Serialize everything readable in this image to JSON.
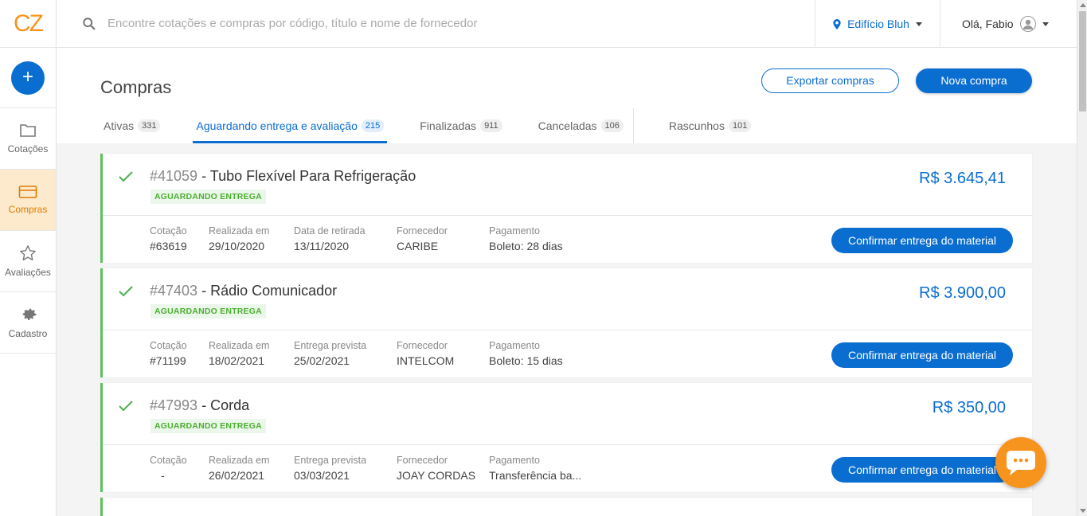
{
  "logo": "CZ",
  "sidebar": {
    "add_label": "+",
    "items": [
      {
        "label": "Cotações",
        "icon": "folder-icon"
      },
      {
        "label": "Compras",
        "icon": "card-icon",
        "active": true
      },
      {
        "label": "Avaliações",
        "icon": "star-icon"
      },
      {
        "label": "Cadastro",
        "icon": "gear-icon"
      }
    ]
  },
  "search": {
    "placeholder": "Encontre cotações e compras por código, título e nome de fornecedor"
  },
  "location": {
    "label": "Edifício Bluh"
  },
  "user": {
    "greeting": "Olá, Fabio"
  },
  "page": {
    "title": "Compras",
    "export_label": "Exportar compras",
    "new_label": "Nova compra"
  },
  "tabs": [
    {
      "label": "Ativas",
      "count": "331"
    },
    {
      "label": "Aguardando entrega e avaliação",
      "count": "215",
      "active": true
    },
    {
      "label": "Finalizadas",
      "count": "911"
    },
    {
      "label": "Canceladas",
      "count": "106"
    },
    {
      "label": "Rascunhos",
      "count": "101"
    }
  ],
  "cards": [
    {
      "code": "#41059",
      "title": " - Tubo Flexível Para Refrigeração",
      "status": "AGUARDANDO ENTREGA",
      "price": "R$ 3.645,41",
      "fields": [
        {
          "label": "Cotação",
          "value": "#63619"
        },
        {
          "label": "Realizada em",
          "value": "29/10/2020"
        },
        {
          "label": "Data de retirada",
          "value": "13/11/2020"
        },
        {
          "label": "Fornecedor",
          "value": "CARIBE"
        },
        {
          "label": "Pagamento",
          "value": "Boleto: 28 dias"
        }
      ],
      "action": "Confirmar entrega do material"
    },
    {
      "code": "#47403",
      "title": " - Rádio Comunicador",
      "status": "AGUARDANDO ENTREGA",
      "price": "R$ 3.900,00",
      "fields": [
        {
          "label": "Cotação",
          "value": "#71199"
        },
        {
          "label": "Realizada em",
          "value": "18/02/2021"
        },
        {
          "label": "Entrega prevista",
          "value": "25/02/2021"
        },
        {
          "label": "Fornecedor",
          "value": "INTELCOM"
        },
        {
          "label": "Pagamento",
          "value": "Boleto: 15 dias"
        }
      ],
      "action": "Confirmar entrega do material"
    },
    {
      "code": "#47993",
      "title": " - Corda",
      "status": "AGUARDANDO ENTREGA",
      "price": "R$ 350,00",
      "fields": [
        {
          "label": "Cotação",
          "value": "-"
        },
        {
          "label": "Realizada em",
          "value": "26/02/2021"
        },
        {
          "label": "Entrega prevista",
          "value": "03/03/2021"
        },
        {
          "label": "Fornecedor",
          "value": "JOAY CORDAS"
        },
        {
          "label": "Pagamento",
          "value": "Transferência ba..."
        }
      ],
      "action": "Confirmar entrega do material"
    }
  ],
  "colors": {
    "accent": "#0a6ed1",
    "brand": "#f7941d",
    "success": "#5cc25c"
  }
}
